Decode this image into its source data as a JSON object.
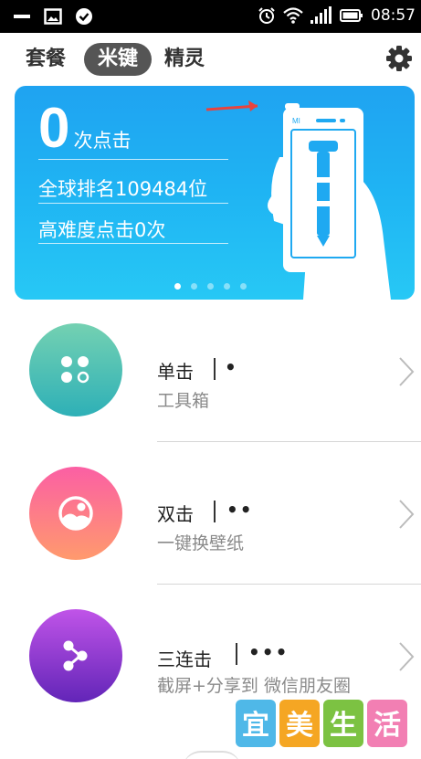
{
  "status_bar": {
    "time": "08:57",
    "left_icons": [
      "minus-icon",
      "image-icon",
      "check-circle-icon"
    ],
    "right_icons": [
      "alarm-icon",
      "wifi-icon",
      "signal-icon",
      "battery-icon"
    ]
  },
  "tabs": [
    {
      "label": "套餐",
      "selected": false
    },
    {
      "label": "米键",
      "selected": true
    },
    {
      "label": "精灵",
      "selected": false
    }
  ],
  "settings_icon": "gear-icon",
  "banner": {
    "count": "0",
    "count_unit": "次点击",
    "rank_text": "全球排名109484位",
    "hard_text": "高难度点击0次",
    "page_indicator": {
      "total": 5,
      "active": 1
    },
    "phone_logo": "MI"
  },
  "items": [
    {
      "title": "单击",
      "dots": "•",
      "subtitle": "工具箱",
      "icon": "grid-dots-icon",
      "colors": [
        "#74d1b2",
        "#2eb0b7"
      ]
    },
    {
      "title": "双击",
      "dots": "••",
      "subtitle": "一键换壁纸",
      "icon": "wallpaper-icon",
      "colors": [
        "#fb5fa4",
        "#ff9a6d"
      ]
    },
    {
      "title": "三连击",
      "dots": "•••",
      "subtitle": "截屏+分享到 微信朋友圈",
      "icon": "share-icon",
      "colors": [
        "#c054e8",
        "#6225b8"
      ]
    }
  ],
  "watermark": [
    "宜",
    "美",
    "生",
    "活"
  ],
  "colors": {
    "banner": "#1fa3f1",
    "tab_selected_bg": "#555555",
    "subtitle": "#8a8a8a"
  }
}
